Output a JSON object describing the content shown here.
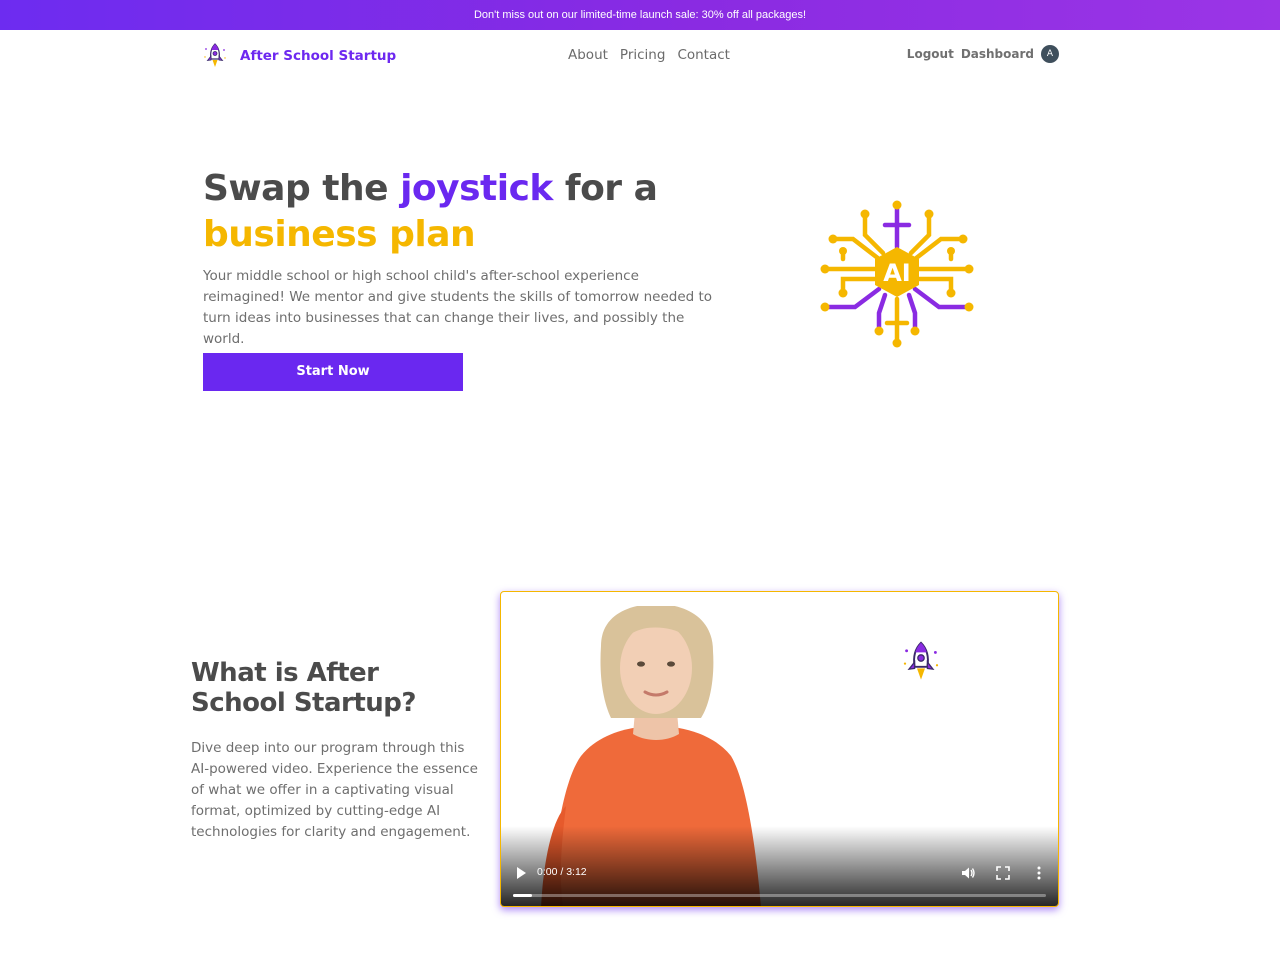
{
  "banner": {
    "text": "Don't miss out on our limited-time launch sale: 30% off all packages!"
  },
  "nav": {
    "brand": "After School Startup",
    "links": [
      {
        "label": "About"
      },
      {
        "label": "Pricing"
      },
      {
        "label": "Contact"
      }
    ],
    "logout": "Logout",
    "dashboard": "Dashboard",
    "avatar_initial": "A"
  },
  "hero": {
    "title_part1": "Swap the ",
    "title_highlight1": "joystick",
    "title_part2": " for a",
    "title_highlight2": "business plan",
    "description": "Your middle school or high school child's after-school experience reimagined! We mentor and give students the skills of tomorrow needed to turn ideas into businesses that can change their lives, and possibly the world.",
    "cta": "Start Now",
    "graphic_label": "AI"
  },
  "about": {
    "title": "What is After School Startup?",
    "description": "Dive deep into our program through this AI-powered video. Experience the essence of what we offer in a captivating visual format, optimized by cutting-edge AI technologies for clarity and engagement."
  },
  "video": {
    "time": "0:00 / 3:12",
    "progress": 0.035
  },
  "colors": {
    "purple": "#6a28f0",
    "yellow": "#f5b700",
    "text": "#4b4b4b"
  },
  "icons": [
    "rocket-icon",
    "ai-circuit-icon",
    "play-icon",
    "volume-icon",
    "fullscreen-icon",
    "more-vertical-icon"
  ]
}
